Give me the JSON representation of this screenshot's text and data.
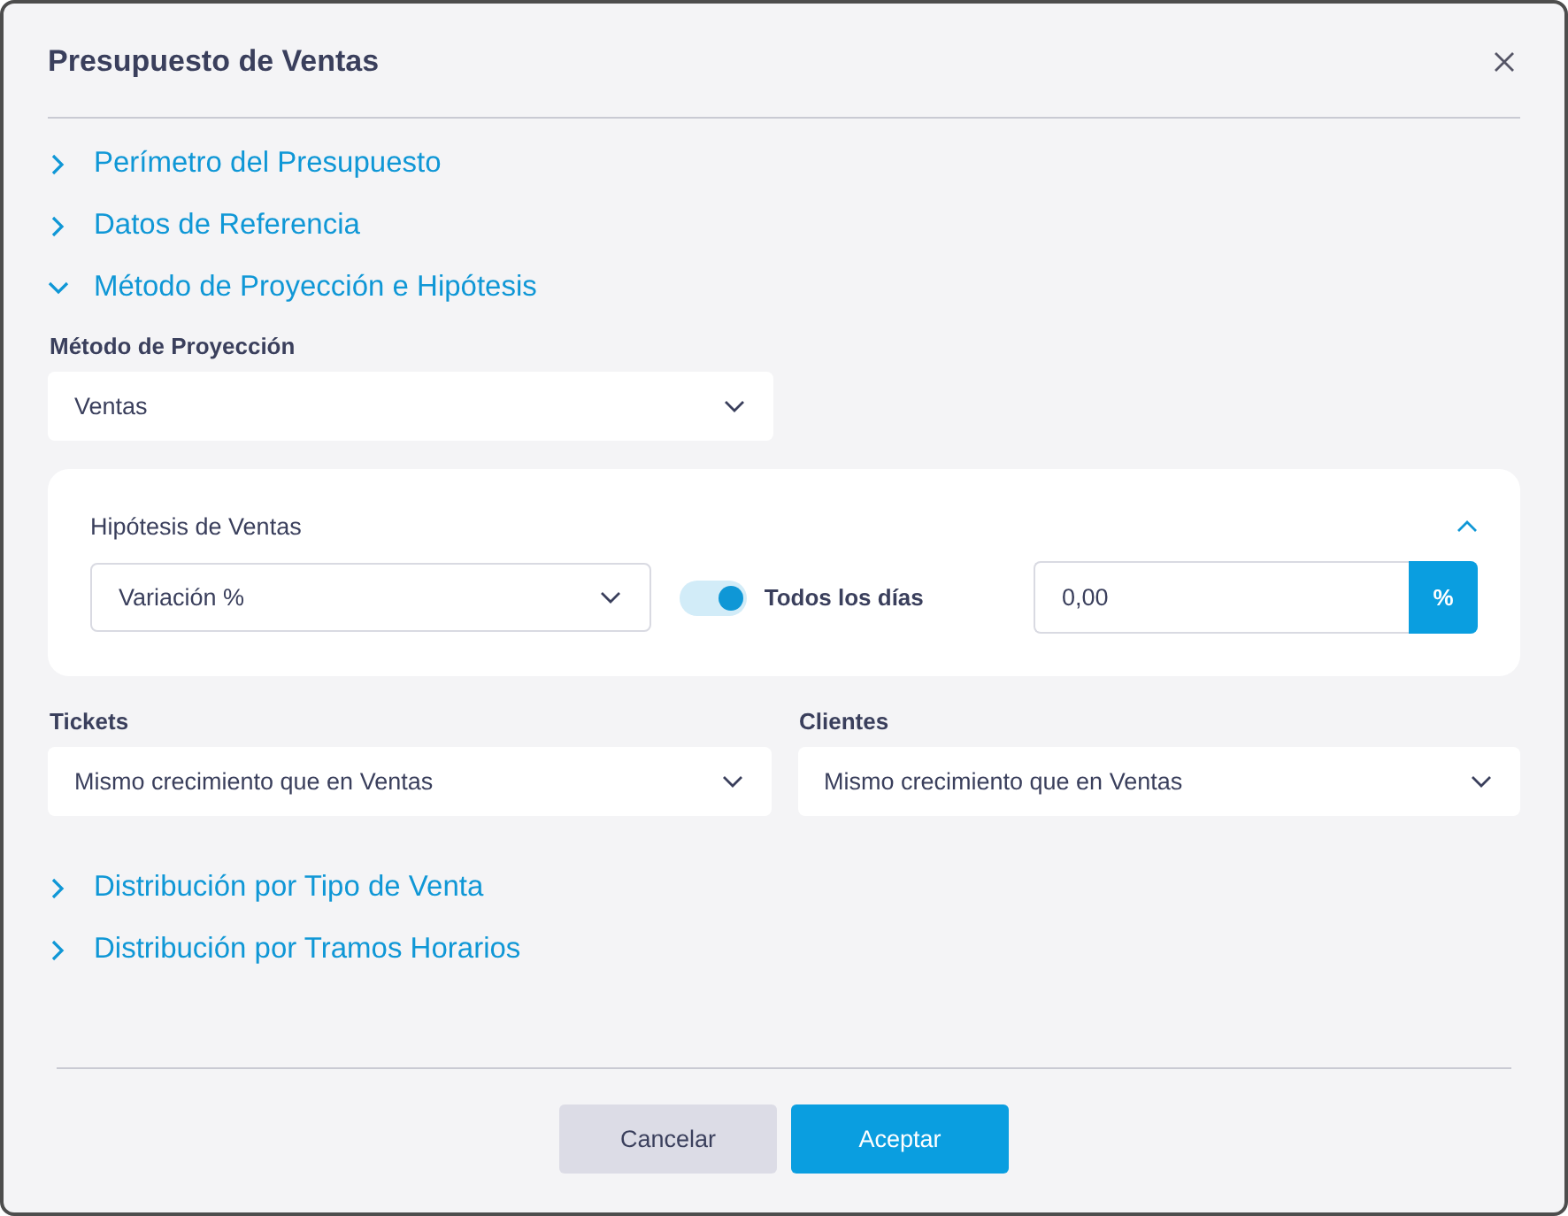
{
  "dialog": {
    "title": "Presupuesto de Ventas"
  },
  "sections_top": [
    {
      "label": "Perímetro del Presupuesto",
      "expanded": false
    },
    {
      "label": "Datos de Referencia",
      "expanded": false
    },
    {
      "label": "Método de Proyección e Hipótesis",
      "expanded": true
    }
  ],
  "method": {
    "label": "Método de Proyección",
    "value": "Ventas"
  },
  "hypothesis": {
    "title": "Hipótesis de Ventas",
    "expanded": true,
    "type_value": "Variación %",
    "toggle": {
      "label": "Todos los días",
      "on": true
    },
    "amount": {
      "value": "0,00",
      "unit": "%"
    }
  },
  "selects": [
    {
      "label": "Tickets",
      "value": "Mismo crecimiento que en Ventas"
    },
    {
      "label": "Clientes",
      "value": "Mismo crecimiento que en Ventas"
    }
  ],
  "sections_bottom": [
    {
      "label": "Distribución por Tipo de Venta",
      "expanded": false
    },
    {
      "label": "Distribución por Tramos Horarios",
      "expanded": false
    }
  ],
  "buttons": [
    {
      "label": "Cancelar",
      "kind": "secondary"
    },
    {
      "label": "Aceptar",
      "kind": "primary"
    }
  ]
}
